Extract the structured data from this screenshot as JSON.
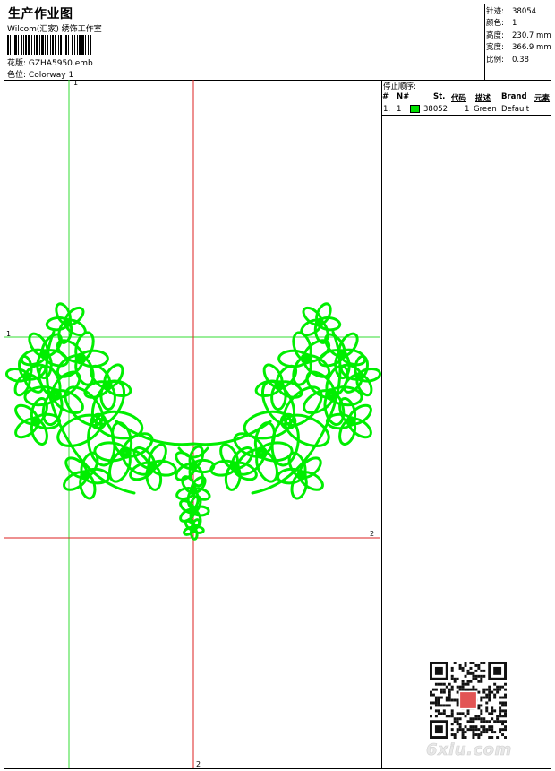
{
  "header": {
    "title": "生产作业图",
    "subtitle": "Wilcom(汇家) 绣饰工作室",
    "design_label": "花版:",
    "design_value": "GZHA5950.emb",
    "color_label": "色位:",
    "color_value": "Colorway 1"
  },
  "stats": [
    {
      "key": "针迹:",
      "value": "38054"
    },
    {
      "key": "颜色:",
      "value": "1"
    },
    {
      "key": "高度:",
      "value": "230.7 mm"
    },
    {
      "key": "宽度:",
      "value": "366.9 mm"
    },
    {
      "key": "比例:",
      "value": "0.38"
    }
  ],
  "sequence": {
    "title": "停止顺序:",
    "columns": [
      "#",
      "N#",
      "St.",
      "代码",
      "描述",
      "Brand",
      "元素"
    ],
    "rows": [
      {
        "idx": "1.",
        "n": "1",
        "swatch_color": "#00e000",
        "st": "38052",
        "code": "1",
        "desc": "Green",
        "brand": "Default",
        "element": ""
      }
    ]
  },
  "guides": {
    "green_h_label": "1",
    "green_v_label": "1",
    "red_h_label": "2",
    "red_v_label": "2",
    "green_color": "#33dd33",
    "red_color": "#dd2222"
  },
  "design_color": "#00ee00",
  "watermark": "6xiu.com"
}
